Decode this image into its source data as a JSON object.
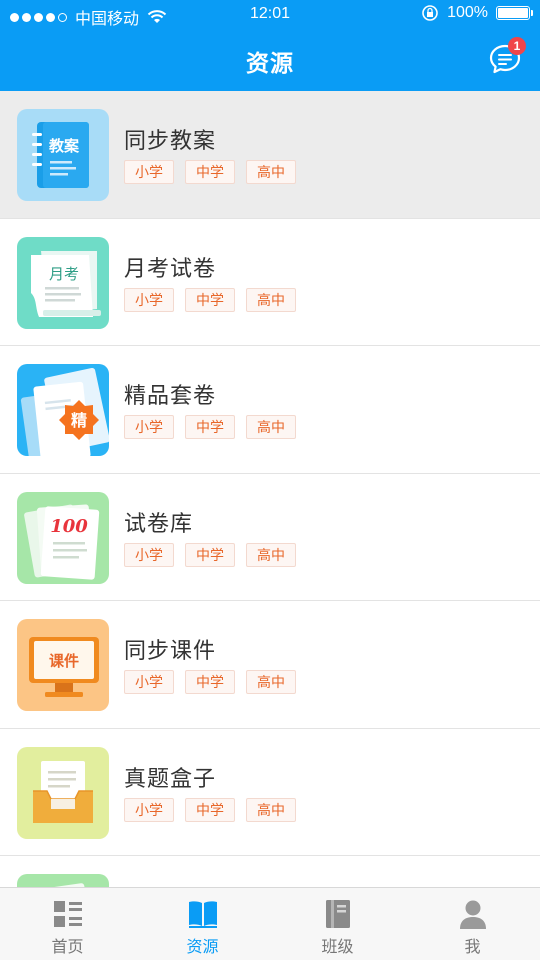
{
  "status_bar": {
    "carrier": "中国移动",
    "time": "12:01",
    "battery": "100%"
  },
  "header": {
    "title": "资源",
    "message_badge": "1"
  },
  "resources": [
    {
      "name": "同步教案",
      "icon_text": "教案",
      "tags": [
        "小学",
        "中学",
        "高中"
      ],
      "icon": "lesson-plan-icon",
      "bg": "#a8dcf7"
    },
    {
      "name": "月考试卷",
      "icon_text": "月考",
      "tags": [
        "小学",
        "中学",
        "高中"
      ],
      "icon": "monthly-exam-icon",
      "bg": "#6fdcc7"
    },
    {
      "name": "精品套卷",
      "icon_text": "精",
      "tags": [
        "小学",
        "中学",
        "高中"
      ],
      "icon": "premium-paper-icon",
      "bg": "#2ab3f5"
    },
    {
      "name": "试卷库",
      "icon_text": "100",
      "tags": [
        "小学",
        "中学",
        "高中"
      ],
      "icon": "exam-library-icon",
      "bg": "#a6e6a8"
    },
    {
      "name": "同步课件",
      "icon_text": "课件",
      "tags": [
        "小学",
        "中学",
        "高中"
      ],
      "icon": "courseware-icon",
      "bg": "#fcc585"
    },
    {
      "name": "真题盒子",
      "icon_text": "",
      "tags": [
        "小学",
        "中学",
        "高中"
      ],
      "icon": "exam-box-icon",
      "bg": "#e2ee9e"
    }
  ],
  "tabs": [
    {
      "label": "首页",
      "icon": "home-grid-icon",
      "active": false
    },
    {
      "label": "资源",
      "icon": "book-icon",
      "active": true
    },
    {
      "label": "班级",
      "icon": "notebook-icon",
      "active": false
    },
    {
      "label": "我",
      "icon": "person-icon",
      "active": false
    }
  ],
  "colors": {
    "brand": "#0a9cf5",
    "tag_text": "#e8672a",
    "badge": "#f0454a"
  }
}
